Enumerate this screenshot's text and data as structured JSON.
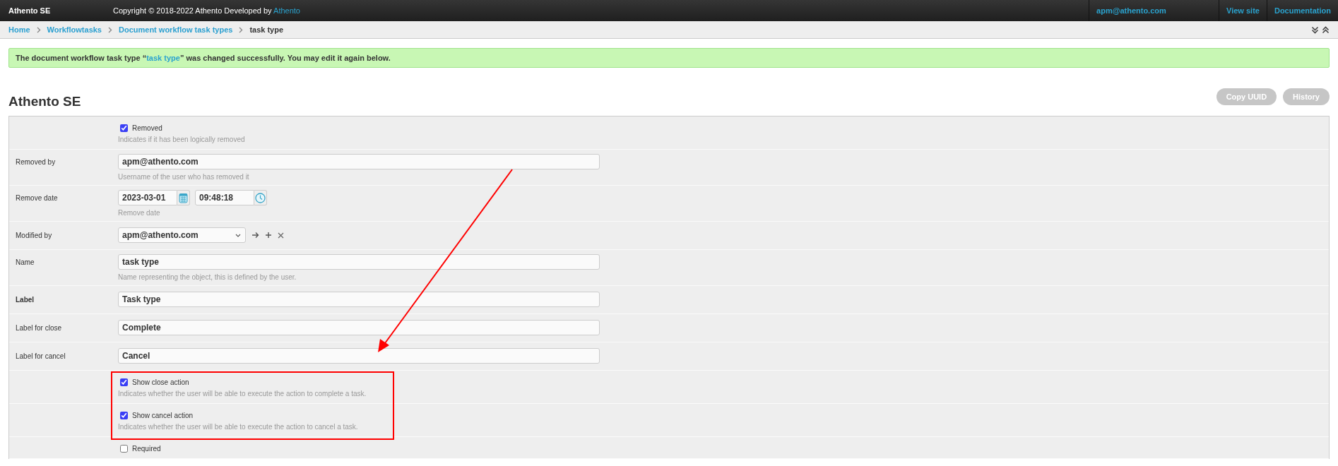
{
  "topbar": {
    "brand": "Athento SE",
    "copyright": "Copyright © 2018-2022 Athento Developed by",
    "copyright_link": "Athento",
    "user": "apm@athento.com",
    "links": [
      "View site",
      "Documentation"
    ]
  },
  "breadcrumbs": [
    {
      "label": "Home",
      "current": false
    },
    {
      "label": "Workflowtasks",
      "current": false
    },
    {
      "label": "Document workflow task types",
      "current": false
    },
    {
      "label": "task type",
      "current": true
    }
  ],
  "message": {
    "before": "The document workflow task type “",
    "link": "task type",
    "after": "” was changed successfully. You may edit it again below."
  },
  "title": "Athento SE",
  "buttons": [
    "Copy UUID",
    "History"
  ],
  "rows": [
    {
      "kind": "checkbox",
      "text": "Removed",
      "checked": true,
      "help": "Indicates if it has been logically removed"
    },
    {
      "kind": "text",
      "label": "Removed by",
      "required": false,
      "value": "apm@athento.com",
      "help": "Username of the user who has removed it"
    },
    {
      "kind": "datetime",
      "label": "Remove date",
      "required": false,
      "date": "2023-03-01",
      "time": "09:48:18",
      "help": "Remove date"
    },
    {
      "kind": "select",
      "label": "Modified by",
      "required": false,
      "value": "apm@athento.com"
    },
    {
      "kind": "text",
      "label": "Name",
      "required": false,
      "value": "task type",
      "help": "Name representing the object, this is defined by the user."
    },
    {
      "kind": "text",
      "label": "Label",
      "required": true,
      "value": "Task type"
    },
    {
      "kind": "text",
      "label": "Label for close",
      "required": false,
      "value": "Complete"
    },
    {
      "kind": "text",
      "label": "Label for cancel",
      "required": false,
      "value": "Cancel"
    },
    {
      "kind": "checkbox",
      "text": "Show close action",
      "checked": true,
      "help": "Indicates whether the user will be able to execute the action to complete a task."
    },
    {
      "kind": "checkbox",
      "text": "Show cancel action",
      "checked": true,
      "help": "Indicates whether the user will be able to execute the action to cancel a task."
    },
    {
      "kind": "checkbox",
      "text": "Required",
      "checked": false
    }
  ]
}
